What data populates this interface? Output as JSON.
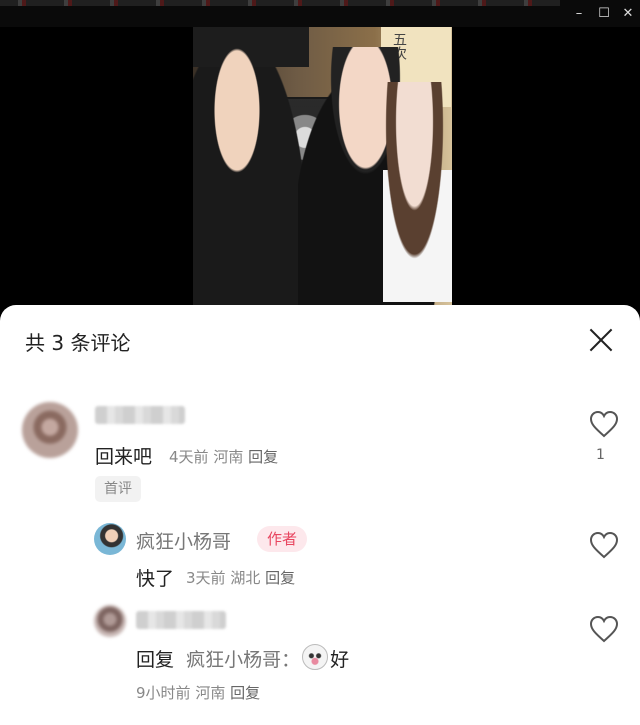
{
  "window": {
    "controls": {
      "minimize": "–",
      "maximize": "☐",
      "close": "✕"
    }
  },
  "video": {
    "sign_text": "五次",
    "description": ""
  },
  "comments_panel": {
    "title": "共 3 条评论",
    "close_icon": "close-icon",
    "comments": [
      {
        "text": "回来吧",
        "time": "4天前",
        "location": "河南",
        "reply_label": "回复",
        "tag": "首评",
        "likes": "1"
      }
    ],
    "replies": [
      {
        "author": "疯狂小杨哥",
        "badge": "作者",
        "text": "快了",
        "time": "3天前",
        "location": "湖北",
        "reply_label": "回复"
      },
      {
        "prefix": "回复",
        "reply_to": "疯狂小杨哥：",
        "text_after_emoji": "好",
        "time": "9小时前",
        "location": "河南",
        "reply_label": "回复"
      }
    ]
  },
  "colors": {
    "badge_bg": "#fde8ec",
    "badge_text": "#e8455f",
    "sheet_bg": "#ffffff"
  }
}
